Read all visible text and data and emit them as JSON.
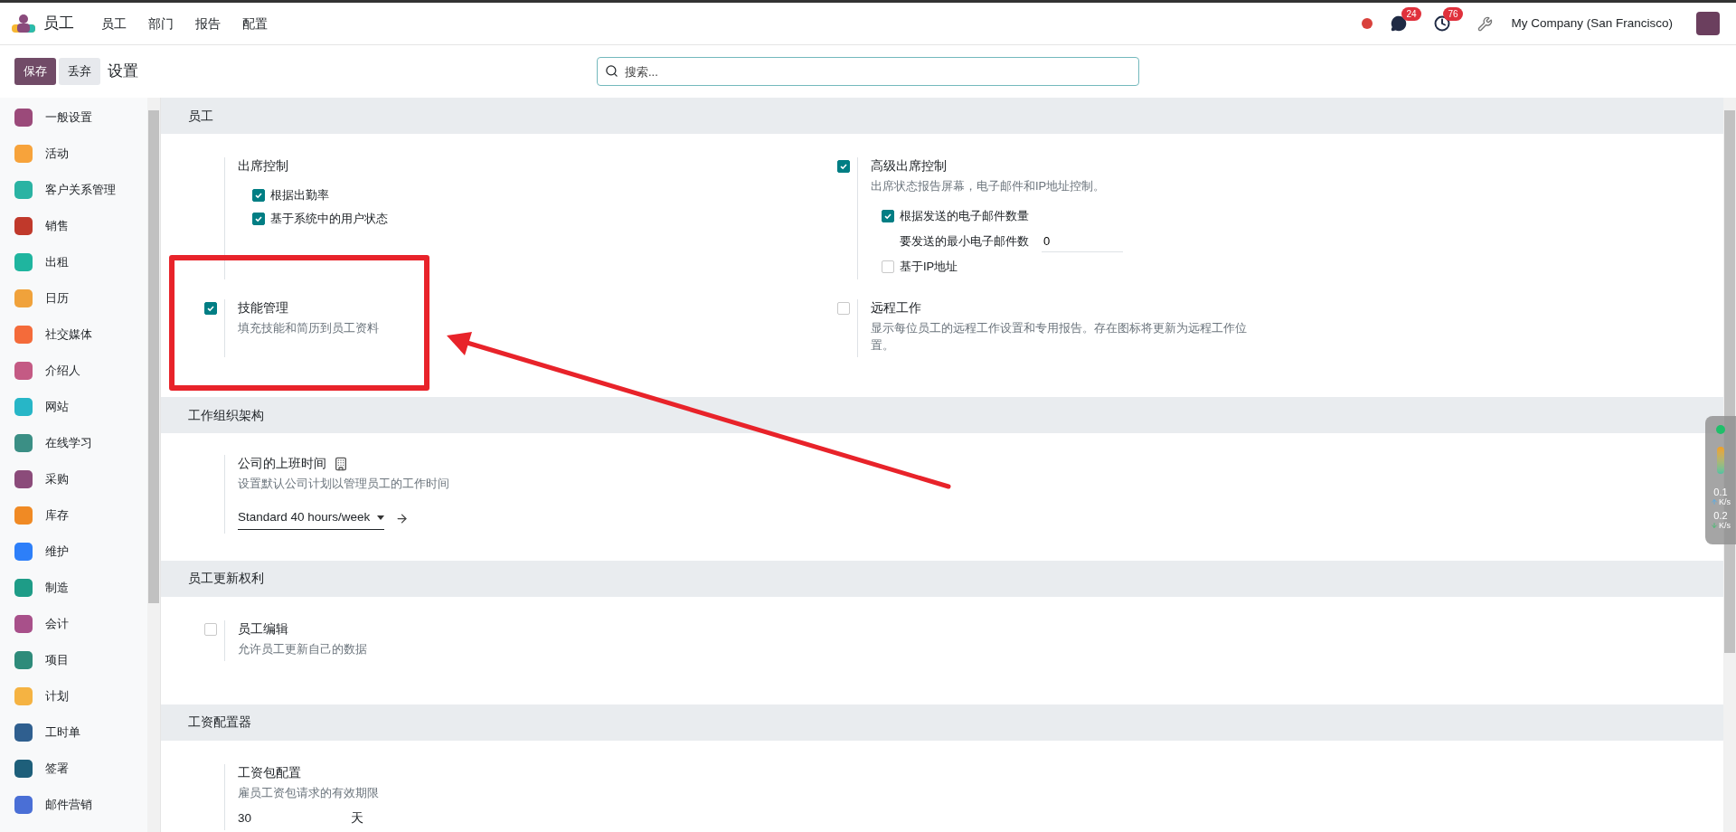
{
  "navbar": {
    "app_name": "员工",
    "menu": [
      "员工",
      "部门",
      "报告",
      "配置"
    ],
    "chat_count": "24",
    "activity_count": "76",
    "company": "My Company (San Francisco)"
  },
  "control_panel": {
    "save": "保存",
    "discard": "丢弃",
    "title": "设置",
    "search": {
      "placeholder": "搜索..."
    }
  },
  "sidebar": {
    "items": [
      {
        "label": "一般设置",
        "selected": false
      },
      {
        "label": "活动",
        "selected": false
      },
      {
        "label": "客户关系管理",
        "selected": false
      },
      {
        "label": "销售",
        "selected": false
      },
      {
        "label": "出租",
        "selected": false
      },
      {
        "label": "日历",
        "selected": false
      },
      {
        "label": "社交媒体",
        "selected": false
      },
      {
        "label": "介绍人",
        "selected": false
      },
      {
        "label": "网站",
        "selected": false
      },
      {
        "label": "在线学习",
        "selected": false
      },
      {
        "label": "采购",
        "selected": false
      },
      {
        "label": "库存",
        "selected": false
      },
      {
        "label": "维护",
        "selected": false
      },
      {
        "label": "制造",
        "selected": false
      },
      {
        "label": "会计",
        "selected": false
      },
      {
        "label": "项目",
        "selected": false
      },
      {
        "label": "计划",
        "selected": false
      },
      {
        "label": "工时单",
        "selected": false
      },
      {
        "label": "签署",
        "selected": false
      },
      {
        "label": "邮件营销",
        "selected": false
      }
    ]
  },
  "sections": [
    {
      "title": "员工",
      "settings": [
        {
          "kind": "group",
          "title": "出席控制",
          "options": [
            {
              "kind": "checkbox",
              "label": "根据出勤率",
              "checked": true
            },
            {
              "kind": "checkbox",
              "label": "基于系统中的用户状态",
              "checked": true
            }
          ]
        },
        {
          "kind": "checkbox",
          "title": "高级出席控制",
          "checked": true,
          "description": "出席状态报告屏幕，电子邮件和IP地址控制。",
          "options": [
            {
              "kind": "checkbox",
              "label": "根据发送的电子邮件数量",
              "checked": true
            },
            {
              "kind": "field",
              "label": "要发送的最小电子邮件数",
              "value": "0"
            },
            {
              "kind": "checkbox",
              "label": "基于IP地址",
              "checked": false
            }
          ]
        },
        {
          "kind": "checkbox",
          "title": "技能管理",
          "checked": true,
          "description": "填充技能和简历到员工资料"
        },
        {
          "kind": "checkbox",
          "title": "远程工作",
          "checked": false,
          "description": "显示每位员工的远程工作设置和专用报告。存在图标将更新为远程工作位置。"
        }
      ]
    },
    {
      "title": "工作组织架构",
      "settings": [
        {
          "kind": "group",
          "title": "公司的上班时间",
          "company_icon": true,
          "description": "设置默认公司计划以管理员工的工作时间",
          "select": "Standard 40 hours/week"
        }
      ]
    },
    {
      "title": "员工更新权利",
      "settings": [
        {
          "kind": "checkbox",
          "title": "员工编辑",
          "checked": false,
          "description": "允许员工更新自己的数据"
        }
      ]
    },
    {
      "title": "工资配置器",
      "settings": [
        {
          "kind": "group",
          "title": "工资包配置",
          "description": "雇员工资包请求的有效期限",
          "duration": {
            "value": "30",
            "unit": "天"
          }
        }
      ]
    }
  ],
  "speed_widget": {
    "upload": "0.1",
    "upload_unit": "K/s",
    "download": "0.2",
    "download_unit": "K/s"
  }
}
